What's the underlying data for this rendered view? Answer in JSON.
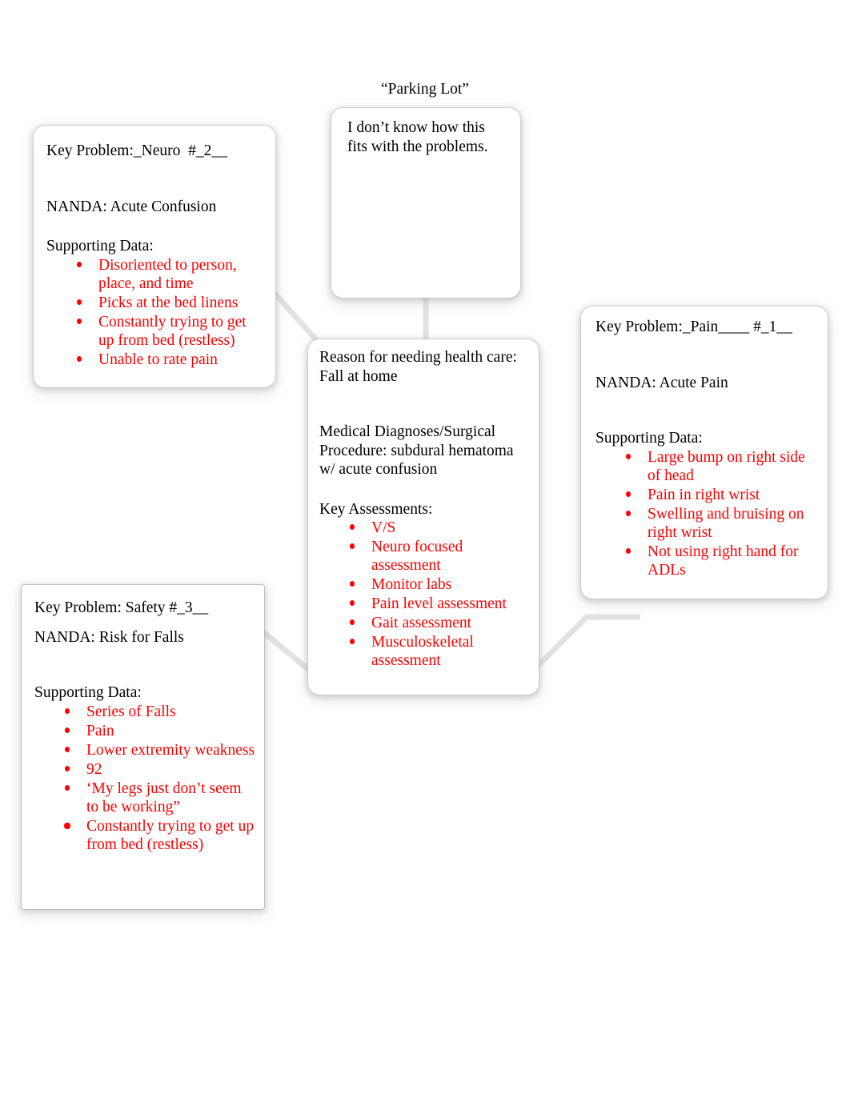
{
  "page": {
    "parking_lot_title": "“Parking Lot”",
    "accent_red": "#ff0000",
    "text_black": "#000000",
    "background": "#ffffff"
  },
  "parking_lot_box": {
    "note": "I don’t know how this fits with the problems."
  },
  "neuro_box": {
    "header": "Key Problem:_Neuro  #_2__",
    "nanda": "NANDA: Acute Confusion",
    "supporting_label": "Supporting Data:",
    "supporting_data": [
      "Disoriented to person, place, and time",
      "Picks at the bed linens",
      "Constantly trying to get up from bed (restless)",
      "Unable to rate pain"
    ]
  },
  "center_box": {
    "reason": "Reason for needing health care: Fall at home",
    "diagnoses": "Medical Diagnoses/Surgical Procedure: subdural hematoma w/ acute confusion",
    "assessments_label": "Key Assessments:",
    "assessments": [
      "V/S",
      "Neuro focused assessment",
      "Monitor labs",
      "Pain level assessment",
      "Gait assessment",
      "Musculoskeletal assessment"
    ]
  },
  "pain_box": {
    "header": "Key Problem:_Pain____ #_1__",
    "nanda": "NANDA: Acute Pain",
    "supporting_label": "Supporting Data:",
    "supporting_data": [
      "Large bump on right side of head",
      "Pain in right wrist",
      "Swelling and bruising on right wrist",
      "Not using right hand for ADLs"
    ]
  },
  "safety_box": {
    "header": "Key Problem: Safety #_3__",
    "nanda": "NANDA: Risk for Falls",
    "supporting_label": "Supporting Data:",
    "supporting_data": [
      "Series of Falls",
      "Pain",
      "Lower extremity weakness",
      "92",
      "‘My legs just don’t seem to be working”",
      "Constantly trying to get up from bed (restless)"
    ]
  }
}
